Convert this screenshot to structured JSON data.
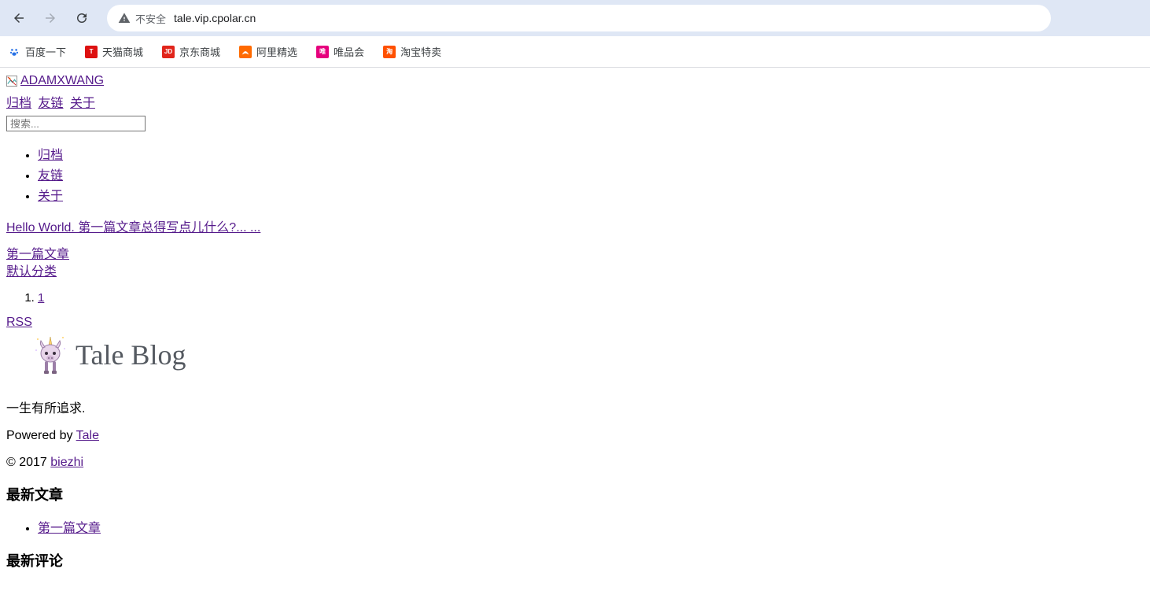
{
  "browser": {
    "security_label": "不安全",
    "url": "tale.vip.cpolar.cn"
  },
  "bookmarks": [
    {
      "label": "百度一下",
      "icon_bg": "#2972e6",
      "icon_fg": "#fff",
      "icon_glyph": "paw"
    },
    {
      "label": "天猫商城",
      "icon_bg": "#d11",
      "icon_fg": "#fff",
      "icon_glyph": "T"
    },
    {
      "label": "京东商城",
      "icon_bg": "#e1251b",
      "icon_fg": "#fff",
      "icon_glyph": "JD"
    },
    {
      "label": "阿里精选",
      "icon_bg": "#ff6a00",
      "icon_fg": "#fff",
      "icon_glyph": "ali"
    },
    {
      "label": "唯品会",
      "icon_bg": "#e6007d",
      "icon_fg": "#fff",
      "icon_glyph": "唯"
    },
    {
      "label": "淘宝特卖",
      "icon_bg": "#ff5000",
      "icon_fg": "#fff",
      "icon_glyph": "淘"
    }
  ],
  "content": {
    "site_logo_alt": "ADAMXWANG",
    "nav_inline": [
      "归档",
      "友链",
      "关于"
    ],
    "search_placeholder": "搜索...",
    "nav_list": [
      "归档",
      "友链",
      "关于"
    ],
    "post_title_line": "Hello World. 第一篇文章总得写点儿什么?... ...",
    "post_meta_1": "第一篇文章",
    "post_meta_2": "默认分类",
    "pagination": [
      "1"
    ],
    "rss_label": "RSS",
    "footer_logo_text": "Tale Blog",
    "slogan": "一生有所追求.",
    "powered_prefix": "Powered by ",
    "powered_link": "Tale",
    "copyright_prefix": "© 2017 ",
    "copyright_link": "biezhi",
    "sections": {
      "latest_posts": "最新文章",
      "latest_posts_items": [
        "第一篇文章"
      ],
      "latest_comments": "最新评论"
    }
  }
}
